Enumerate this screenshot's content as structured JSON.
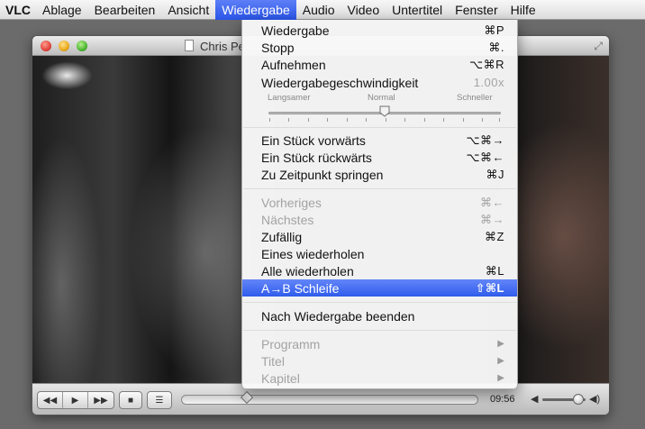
{
  "menubar": {
    "app": "VLC",
    "items": [
      "Ablage",
      "Bearbeiten",
      "Ansicht",
      "Wiedergabe",
      "Audio",
      "Video",
      "Untertitel",
      "Fenster",
      "Hilfe"
    ]
  },
  "window": {
    "title": "Chris Pe",
    "time": "09:56",
    "playback_position": 0.22,
    "volume_level": 0.83
  },
  "menu": {
    "items": [
      {
        "label": "Wiedergabe",
        "shortcut": "⌘P"
      },
      {
        "label": "Stopp",
        "shortcut": "⌘."
      },
      {
        "label": "Aufnehmen",
        "shortcut": "⌥⌘R"
      },
      {
        "label": "Wiedergabegeschwindigkeit",
        "shortcut": "1.00x"
      },
      {
        "label": "Ein Stück vorwärts",
        "shortcut": "⌥⌘→"
      },
      {
        "label": "Ein Stück rückwärts",
        "shortcut": "⌥⌘←"
      },
      {
        "label": "Zu Zeitpunkt springen",
        "shortcut": "⌘J"
      },
      {
        "label": "Vorheriges",
        "shortcut": "⌘←"
      },
      {
        "label": "Nächstes",
        "shortcut": "⌘→"
      },
      {
        "label": "Zufällig",
        "shortcut": "⌘Z"
      },
      {
        "label": "Eines wiederholen",
        "shortcut": ""
      },
      {
        "label": "Alle wiederholen",
        "shortcut": "⌘L"
      },
      {
        "label": "A→B Schleife",
        "shortcut": "⇧⌘L"
      },
      {
        "label": "Nach Wiedergabe beenden",
        "shortcut": ""
      },
      {
        "label": "Programm",
        "shortcut": "▶"
      },
      {
        "label": "Titel",
        "shortcut": "▶"
      },
      {
        "label": "Kapitel",
        "shortcut": "▶"
      }
    ],
    "speed": {
      "slower": "Langsamer",
      "normal": "Normal",
      "faster": "Schneller",
      "position": 0.5
    }
  },
  "colors": {
    "highlight": "#2f5cec",
    "disabled_text": "#a3a3a3"
  }
}
